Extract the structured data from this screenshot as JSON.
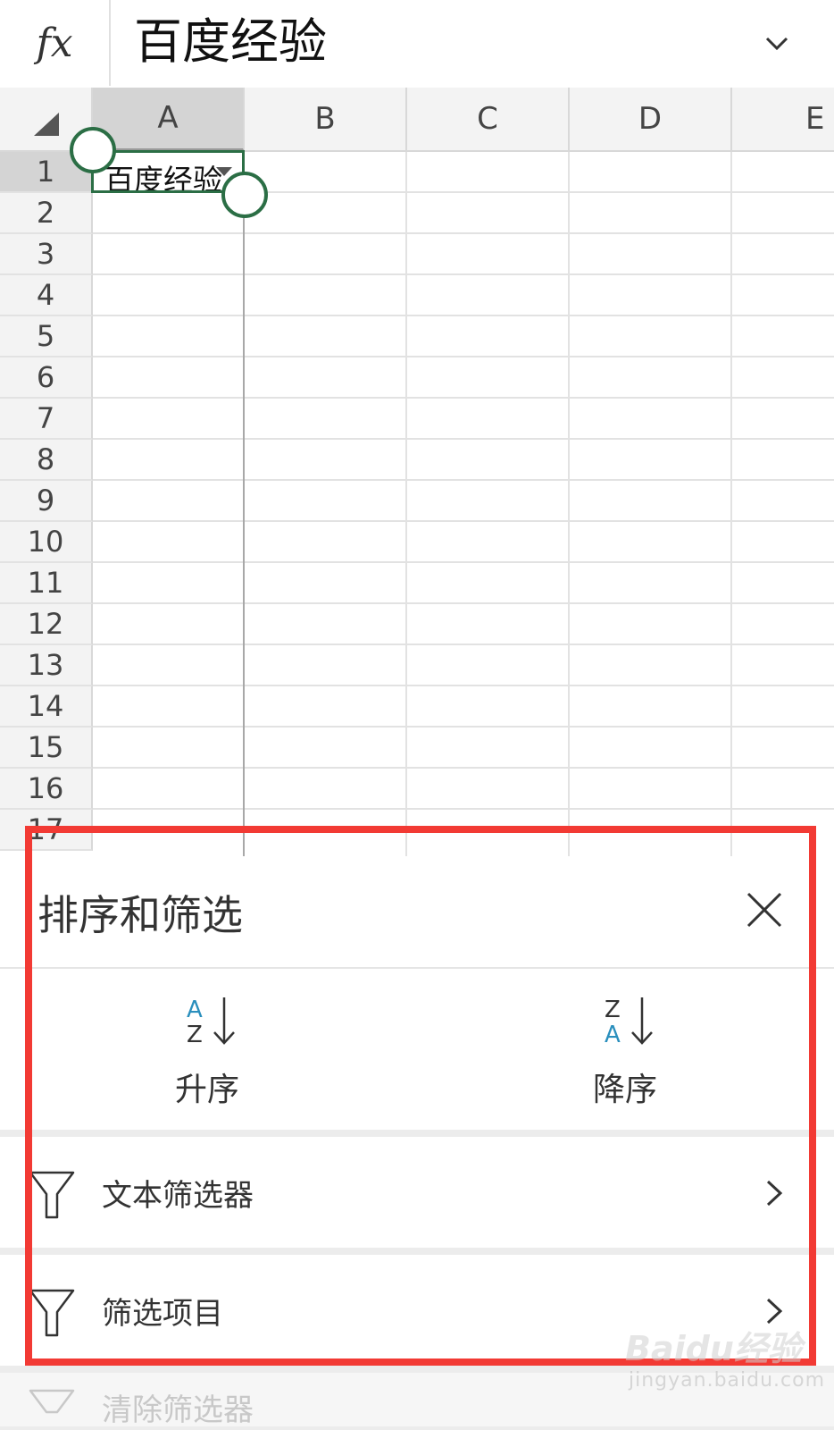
{
  "formula_bar": {
    "fx_label": "fx",
    "value": "百度经验"
  },
  "sheet": {
    "columns": [
      "A",
      "B",
      "C",
      "D",
      "E"
    ],
    "rows": [
      "1",
      "2",
      "3",
      "4",
      "5",
      "6",
      "7",
      "8",
      "9",
      "10",
      "11",
      "12",
      "13",
      "14",
      "15",
      "16",
      "17"
    ],
    "selected_cell_text": "百度经验",
    "selection_color": "#2b6e45"
  },
  "sort_panel": {
    "title": "排序和筛选",
    "ascending": {
      "label": "升序",
      "icon_top": "A",
      "icon_bottom": "Z"
    },
    "descending": {
      "label": "降序",
      "icon_top": "Z",
      "icon_bottom": "A"
    },
    "items": [
      {
        "label": "文本筛选器"
      },
      {
        "label": "筛选项目"
      }
    ],
    "clear_label": "清除筛选器",
    "accent_color": "#2a8fbd"
  },
  "annotation": {
    "color": "#f23a34"
  },
  "watermark": {
    "text": "Baidu经验",
    "sub": "jingyan.baidu.com"
  }
}
